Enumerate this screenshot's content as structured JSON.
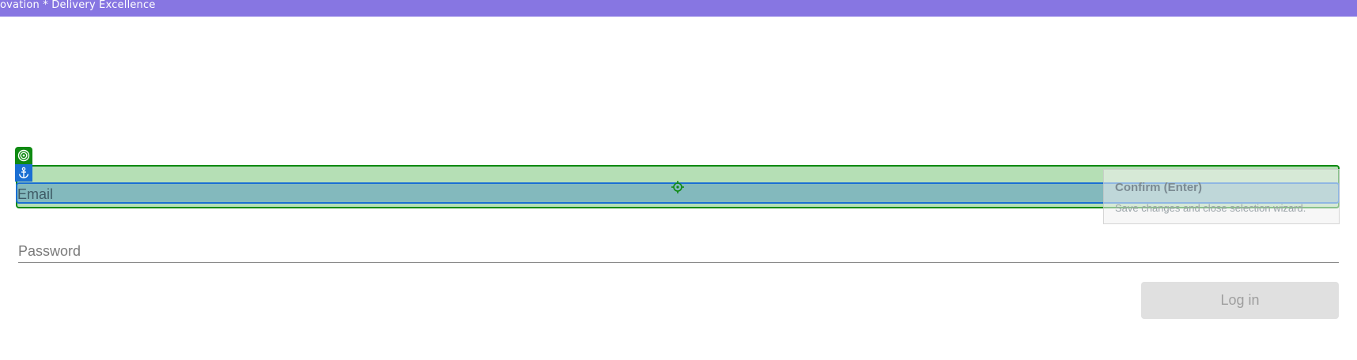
{
  "banner": {
    "text": "ovation * Delivery Excellence",
    "color": "#8776e2"
  },
  "form": {
    "email": {
      "placeholder": "Email",
      "value": ""
    },
    "password": {
      "placeholder": "Password",
      "value": ""
    },
    "login_label": "Log in"
  },
  "tooltip": {
    "title": "Confirm (Enter)",
    "description": "Save changes and close selection wizard."
  },
  "overlay": {
    "target_color": "#0f8a12",
    "anchor_color": "#1a6fd3",
    "icons": [
      "target-icon",
      "anchor-icon",
      "crosshair-icon"
    ]
  }
}
